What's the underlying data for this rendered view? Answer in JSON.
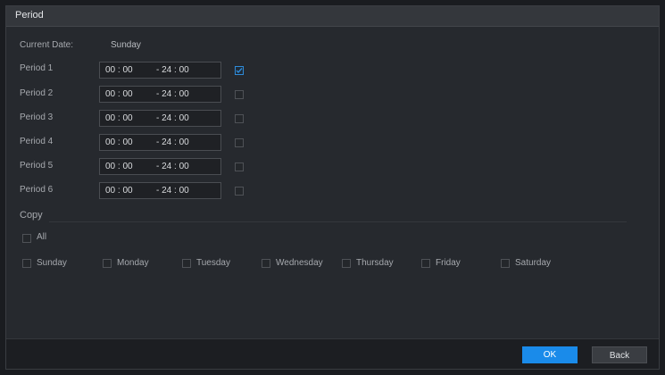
{
  "dialog": {
    "title": "Period"
  },
  "current_date": {
    "label": "Current Date:",
    "value": "Sunday"
  },
  "periods": [
    {
      "label": "Period 1",
      "start": "00 : 00",
      "end": "- 24 : 00",
      "checked": true
    },
    {
      "label": "Period 2",
      "start": "00 : 00",
      "end": "- 24 : 00",
      "checked": false
    },
    {
      "label": "Period 3",
      "start": "00 : 00",
      "end": "- 24 : 00",
      "checked": false
    },
    {
      "label": "Period 4",
      "start": "00 : 00",
      "end": "- 24 : 00",
      "checked": false
    },
    {
      "label": "Period 5",
      "start": "00 : 00",
      "end": "- 24 : 00",
      "checked": false
    },
    {
      "label": "Period 6",
      "start": "00 : 00",
      "end": "- 24 : 00",
      "checked": false
    }
  ],
  "copy": {
    "label": "Copy",
    "all_label": "All",
    "days": [
      {
        "label": "Sunday",
        "checked": false
      },
      {
        "label": "Monday",
        "checked": false
      },
      {
        "label": "Tuesday",
        "checked": false
      },
      {
        "label": "Wednesday",
        "checked": false
      },
      {
        "label": "Thursday",
        "checked": false
      },
      {
        "label": "Friday",
        "checked": false
      },
      {
        "label": "Saturday",
        "checked": false
      }
    ]
  },
  "footer": {
    "ok_label": "OK",
    "back_label": "Back"
  },
  "colors": {
    "accent": "#1a8bea",
    "background": "#26292e",
    "titlebar": "#34373c"
  }
}
